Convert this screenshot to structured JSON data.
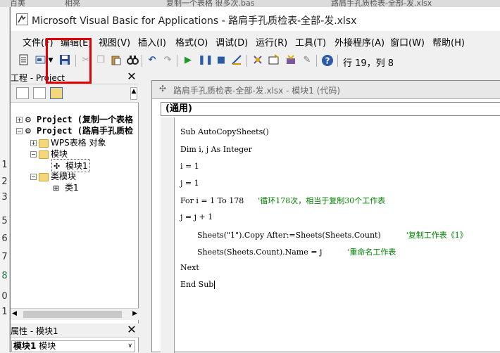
{
  "background_tabs": [
    "百美",
    "相亮",
    "复制一个表格 很多次.bas",
    "路肩手孔质检表-全部-发.xlsx"
  ],
  "left_row_numbers": [
    "1",
    "2",
    "3",
    "5",
    "6",
    "7",
    "8",
    "0",
    "1"
  ],
  "window": {
    "title": "Microsoft Visual Basic for Applications - 路肩手孔质检表-全部-发.xlsx"
  },
  "menu": [
    "文件(F)",
    "编辑(E)",
    "视图(V)",
    "插入(I)",
    "格式(O)",
    "调试(D)",
    "运行(R)",
    "工具(T)",
    "外接程序(A)",
    "窗口(W)",
    "帮助(H)"
  ],
  "toolbar": {
    "status": "行 19，列 8"
  },
  "project_pane": {
    "title": "工程 - Project",
    "tree": [
      {
        "label": "Project (复制一个表格",
        "level": 0,
        "expander": "+"
      },
      {
        "label": "Project (路肩手孔质检",
        "level": 0,
        "expander": "-"
      },
      {
        "label": "WPS表格 对象",
        "level": 1,
        "expander": "+"
      },
      {
        "label": "模块",
        "level": 1,
        "expander": "-"
      },
      {
        "label": "模块1",
        "level": 2,
        "expander": ""
      },
      {
        "label": "类模块",
        "level": 1,
        "expander": "-"
      },
      {
        "label": "类1",
        "level": 2,
        "expander": ""
      }
    ]
  },
  "properties_pane": {
    "title": "属性 - 模块1",
    "object": "模块1",
    "object_type": "模块"
  },
  "code_window": {
    "title": "路肩手孔质检表-全部-发.xlsx - 模块1 (代码)",
    "combo": "(通用)",
    "lines": [
      {
        "code": "Sub AutoCopySheets()",
        "comment": "",
        "indent": 0
      },
      {
        "code": "Dim i, j As Integer",
        "comment": "",
        "indent": 0
      },
      {
        "code": "i = 1",
        "comment": "",
        "indent": 0
      },
      {
        "code": "j = 1",
        "comment": "",
        "indent": 0
      },
      {
        "code": "For i = 1 To 178",
        "comment": "'循环178次，相当于复制30个工作表",
        "indent": 0
      },
      {
        "code": "j = j + 1",
        "comment": "",
        "indent": 0
      },
      {
        "code": "Sheets(\"1\").Copy After:=Sheets(Sheets.Count)",
        "comment": "'复制工作表《1》",
        "indent": 1
      },
      {
        "code": "Sheets(Sheets.Count).Name = j",
        "comment": "'重命名工作表",
        "indent": 1
      },
      {
        "code": "Next",
        "comment": "",
        "indent": 0
      },
      {
        "code": "End Sub",
        "comment": "",
        "indent": 0
      }
    ]
  },
  "colors": {
    "highlight": "#e10000",
    "comment": "#008000"
  }
}
